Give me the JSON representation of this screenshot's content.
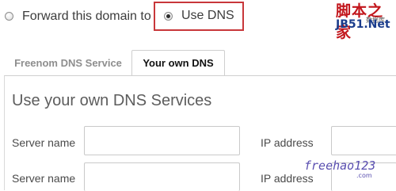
{
  "options": {
    "forward": {
      "label": "Forward this domain to",
      "checked": false
    },
    "dns": {
      "label": "Use DNS",
      "checked": true
    }
  },
  "watermark_top": {
    "brand_cn": "脚本之家",
    "small_text": "数据库",
    "site": "JB51.Net"
  },
  "tabs": [
    {
      "label": "Freenom DNS Service",
      "active": false
    },
    {
      "label": "Your own DNS",
      "active": true
    }
  ],
  "panel": {
    "heading": "Use your own DNS Services",
    "rows": [
      {
        "server_label": "Server name",
        "server_value": "",
        "ip_label": "IP address",
        "ip_value": ""
      },
      {
        "server_label": "Server name",
        "server_value": "",
        "ip_label": "IP address",
        "ip_value": ""
      }
    ]
  },
  "watermark_bottom": {
    "text": "freehao123",
    "suffix": ".com"
  },
  "colors": {
    "highlight_border": "#c8373a",
    "watermark_red": "#c2161c",
    "watermark_blue": "#1a3c8c"
  }
}
